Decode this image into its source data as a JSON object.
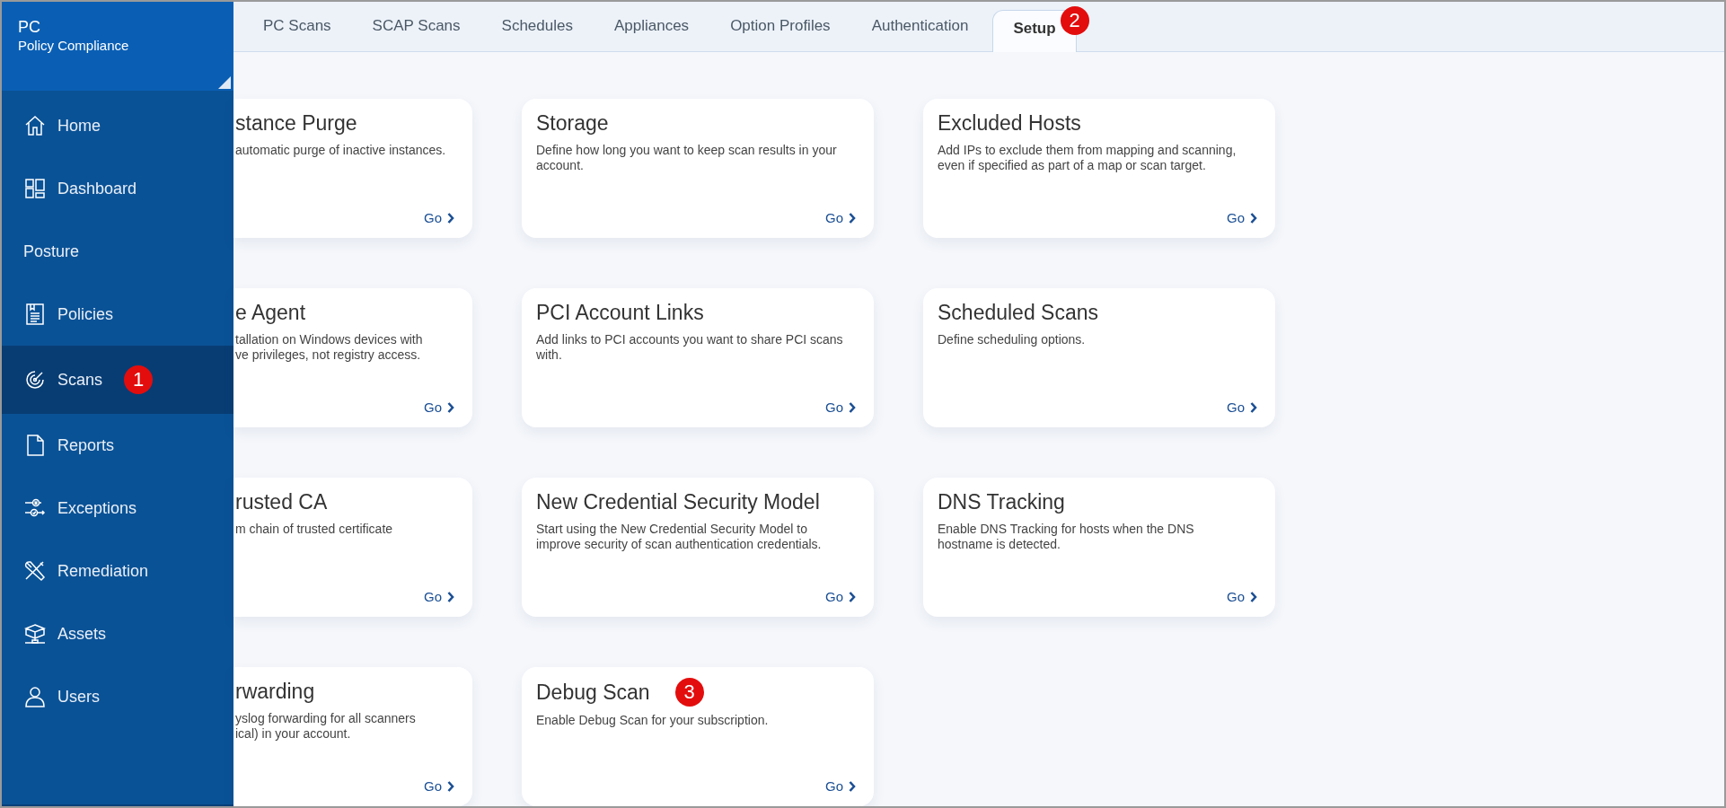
{
  "app": {
    "code": "PC",
    "name": "Policy Compliance"
  },
  "nav": [
    {
      "label": "Home",
      "kind": "home",
      "selected": false
    },
    {
      "label": "Dashboard",
      "kind": "dashboard",
      "selected": false
    },
    {
      "label": "Posture",
      "kind": "plain",
      "selected": false
    },
    {
      "label": "Policies",
      "kind": "policy",
      "selected": false
    },
    {
      "label": "Scans",
      "kind": "scans",
      "selected": true,
      "badge": "1"
    },
    {
      "label": "Reports",
      "kind": "report",
      "selected": false
    },
    {
      "label": "Exceptions",
      "kind": "exceptions",
      "selected": false
    },
    {
      "label": "Remediation",
      "kind": "tools",
      "selected": false
    },
    {
      "label": "Assets",
      "kind": "assets",
      "selected": false
    },
    {
      "label": "Users",
      "kind": "user",
      "selected": false
    }
  ],
  "tabs": [
    {
      "label": "PC Scans",
      "selected": false
    },
    {
      "label": "SCAP Scans",
      "selected": false
    },
    {
      "label": "Schedules",
      "selected": false
    },
    {
      "label": "Appliances",
      "selected": false
    },
    {
      "label": "Option Profiles",
      "selected": false
    },
    {
      "label": "Authentication",
      "selected": false
    },
    {
      "label": "Setup",
      "selected": true,
      "badge": "2"
    }
  ],
  "cards": [
    {
      "title": "stance Purge",
      "description": "automatic purge of inactive instances.",
      "link": "Go",
      "clipped": true
    },
    {
      "title": "Storage",
      "description": "Define how long you want to keep scan results in your account.",
      "link": "Go",
      "clipped": false
    },
    {
      "title": "Excluded Hosts",
      "description": "Add IPs to exclude them from mapping and scanning, even if specified as part of a map or scan target.",
      "link": "Go",
      "clipped": false
    },
    {
      "title": "e Agent",
      "description": "tallation on Windows devices with\nve privileges, not registry access.",
      "link": "Go",
      "clipped": true
    },
    {
      "title": "PCI Account Links",
      "description": "Add links to PCI accounts you want to share PCI scans with.",
      "link": "Go",
      "clipped": false
    },
    {
      "title": "Scheduled Scans",
      "description": "Define scheduling options.",
      "link": "Go",
      "clipped": false
    },
    {
      "title": "rusted CA",
      "description": "m chain of trusted certificate",
      "link": "Go",
      "clipped": true
    },
    {
      "title": "New Credential Security Model",
      "description": "Start using the New Credential Security Model to improve security of scan authentication credentials.",
      "link": "Go",
      "clipped": false
    },
    {
      "title": "DNS Tracking",
      "description": "Enable DNS Tracking for hosts when the DNS hostname is detected.",
      "link": "Go",
      "clipped": false
    },
    {
      "title": "rwarding",
      "description": "yslog forwarding for all scanners\nical) in your account.",
      "link": "Go",
      "clipped": true
    },
    {
      "title": "Debug Scan",
      "description": "Enable Debug Scan for your subscription.",
      "link": "Go",
      "clipped": false,
      "badge": "3"
    }
  ]
}
